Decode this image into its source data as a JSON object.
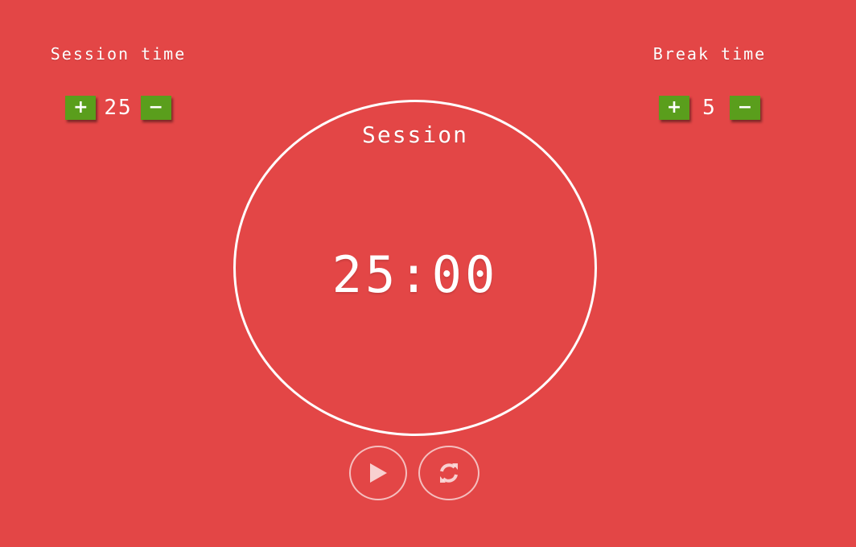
{
  "session": {
    "title": "Session time",
    "value": "25",
    "increase_icon": "plus-icon",
    "decrease_icon": "minus-icon"
  },
  "break": {
    "title": "Break time",
    "value": "5",
    "increase_icon": "plus-icon",
    "decrease_icon": "minus-icon"
  },
  "timer": {
    "label": "Session",
    "display": "25:00"
  },
  "actions": {
    "play_icon": "play-icon",
    "reset_icon": "refresh-icon"
  },
  "colors": {
    "background": "#e34646",
    "button_green": "#5a9e1c",
    "text": "#ffffff"
  }
}
